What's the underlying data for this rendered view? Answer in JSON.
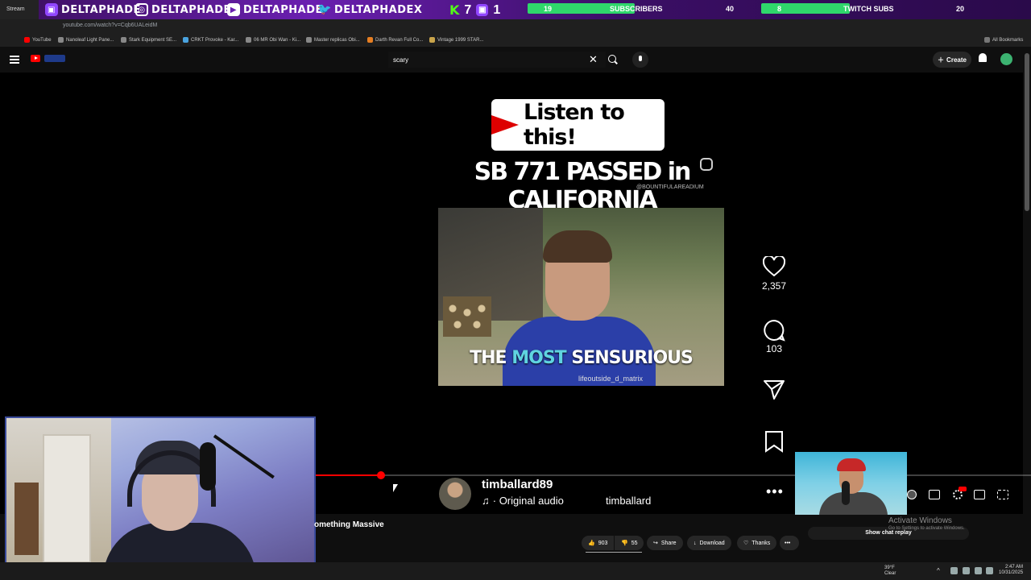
{
  "overlay": {
    "tab0": "Stream",
    "socials": [
      {
        "icon": "twitch-icon",
        "handle": "DELTAPHADE"
      },
      {
        "icon": "instagram-icon",
        "handle": "DELTAPHADE"
      },
      {
        "icon": "youtube-icon",
        "handle": "DELTAPHADE"
      },
      {
        "icon": "twitter-icon",
        "handle": "DELTAPHADEX"
      }
    ],
    "kick_count": "7",
    "twitch_count": "1",
    "subs_goal": {
      "label": "SUBSCRIBERS",
      "current": "19",
      "target": "40",
      "progress": 0.475
    },
    "twitch_subs_goal": {
      "label": "TWITCH SUBS",
      "current": "8",
      "target": "20",
      "progress": 0.4
    },
    "colors": {
      "kick": "#53fc18",
      "twitch": "#9146ff",
      "goal_fill": "#2fd66b"
    }
  },
  "browser": {
    "url": "youtube.com/watch?v=Cqb6UALeidM",
    "bookmarks": [
      "YouTube",
      "Nanoleaf Light Pane...",
      "Stark Equipment SE...",
      "CRKT Provoke - Kar...",
      "06 MR Obi Wan - Ki...",
      "Master replicas Obi...",
      "Darth Revan Full Co...",
      "Vintage 1999 STAR..."
    ],
    "all_bookmarks": "All Bookmarks"
  },
  "masthead": {
    "search_value": "scary",
    "create_label": "Create"
  },
  "short": {
    "banner": "Listen to this!",
    "headline": "SB 771 PASSED in CALIFORNIA",
    "watermark": "@BOUNTIFULAREADIUM",
    "caption_pre": "THE ",
    "caption_hl": "MOST",
    "caption_post": " SENSURIOUS",
    "ig_handle": "lifeoutside_d_matrix",
    "likes": "2,357",
    "comments": "103",
    "channel": "timballard89",
    "audio": "· Original audio",
    "audio_user": "timballard",
    "progress": 0.093
  },
  "below": {
    "title": "omething Massive",
    "likes": "903",
    "dislikes": "55",
    "share": "Share",
    "download": "Download",
    "thanks": "Thanks",
    "show_chat_replay": "Show chat replay",
    "activate_title": "Activate Windows",
    "activate_sub": "Go to Settings to activate Windows."
  },
  "taskbar": {
    "temp": "39°F",
    "weather": "Clear",
    "time": "2:47 AM",
    "date": "10/31/2025"
  }
}
